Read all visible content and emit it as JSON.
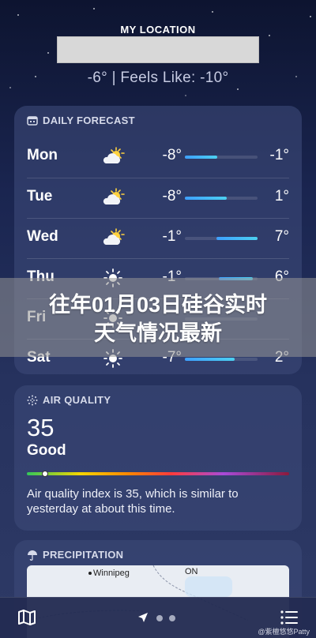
{
  "header": {
    "location_label": "MY LOCATION",
    "temp_line": "-6° | Feels Like: -10°"
  },
  "forecast": {
    "title": "DAILY FORECAST",
    "days": [
      {
        "day": "Mon",
        "icon": "partly-cloudy-icon",
        "low": "-8°",
        "high": "-1°",
        "range": [
          0.0,
          0.45
        ]
      },
      {
        "day": "Tue",
        "icon": "partly-cloudy-icon",
        "low": "-8°",
        "high": "1°",
        "range": [
          0.0,
          0.58
        ]
      },
      {
        "day": "Wed",
        "icon": "partly-cloudy-icon",
        "low": "-1°",
        "high": "7°",
        "range": [
          0.43,
          1.0
        ]
      },
      {
        "day": "Thu",
        "icon": "sun-icon",
        "low": "-1°",
        "high": "6°",
        "range": [
          0.47,
          0.93
        ]
      },
      {
        "day": "Fri",
        "icon": "sun-icon",
        "low": "",
        "high": "",
        "range": [
          0.0,
          0.0
        ]
      },
      {
        "day": "Sat",
        "icon": "sun-icon",
        "low": "-7°",
        "high": "2°",
        "range": [
          0.0,
          0.68
        ]
      }
    ]
  },
  "overlay": {
    "line1": "往年01月03日硅谷实时",
    "line2": "天气情况最新"
  },
  "air_quality": {
    "title": "AIR QUALITY",
    "value": "35",
    "level": "Good",
    "index_fraction": 0.07,
    "description": "Air quality index is 35, which is similar to yesterday at about this time."
  },
  "precipitation": {
    "title": "PRECIPITATION",
    "map_labels": [
      "Winnipeg",
      "ON"
    ]
  },
  "bottom_bar": {
    "map_icon": "map-icon",
    "location_icon": "location-arrow-icon",
    "list_icon": "list-icon"
  },
  "watermark": "@紫檀悠悠Patty",
  "colors": {
    "range_start": "#3ea0ff",
    "range_end": "#4cd0f0"
  }
}
